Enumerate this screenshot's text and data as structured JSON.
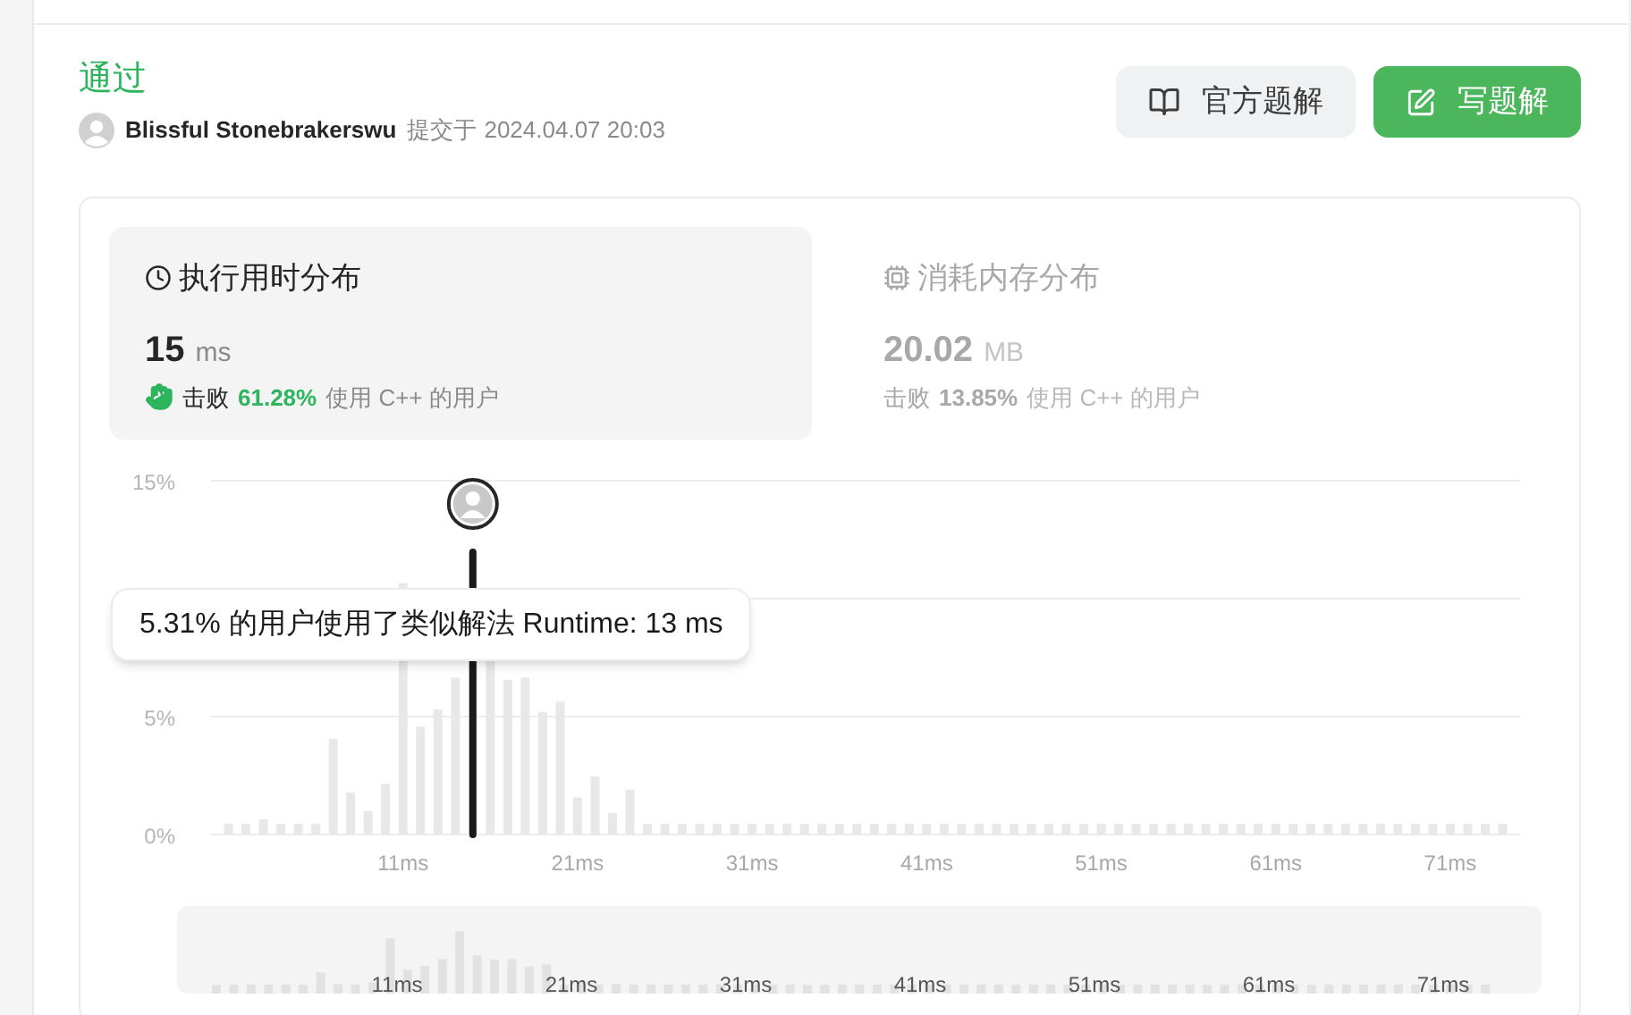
{
  "header": {
    "verdict": "通过",
    "user": "Blissful Stonebrakerswu",
    "submitted_label": "提交于",
    "submitted_time": "2024.04.07 20:03"
  },
  "buttons": [
    {
      "label": "官方题解",
      "kind": "secondary"
    },
    {
      "label": "写题解",
      "kind": "primary"
    }
  ],
  "stats": [
    {
      "kind": "time",
      "title": "执行用时分布",
      "value": "15",
      "unit": "ms",
      "beat_label": "击败",
      "beat_percent": "61.28%",
      "beat_suffix": "使用 C++ 的用户",
      "selected": true
    },
    {
      "kind": "memory",
      "title": "消耗内存分布",
      "value": "20.02",
      "unit": "MB",
      "beat_label": "击败",
      "beat_percent": "13.85%",
      "beat_suffix": "使用 C++ 的用户",
      "selected": false
    }
  ],
  "chart": {
    "chart_data": {
      "type": "bar",
      "x": [
        1,
        2,
        3,
        4,
        5,
        6,
        7,
        8,
        9,
        10,
        11,
        12,
        13,
        14,
        15,
        16,
        17,
        18,
        19,
        20,
        21,
        22,
        23,
        24,
        25,
        26,
        27,
        28,
        29,
        30,
        31,
        32,
        33,
        34,
        35,
        36,
        37,
        38,
        39,
        40,
        41,
        42,
        43,
        44,
        45,
        46,
        47,
        48,
        49,
        50,
        51,
        52,
        53,
        54,
        55,
        56,
        57,
        58,
        59,
        60,
        61,
        62,
        63,
        64,
        65,
        66,
        67,
        68,
        69,
        70,
        71,
        72,
        73,
        74
      ],
      "xlim": [
        0,
        75
      ],
      "series": [
        {
          "color": "#e8e8e8",
          "values": [
            0.45,
            0.45,
            0.65,
            0.45,
            0.45,
            0.45,
            4.06,
            1.78,
            1.0,
            2.16,
            10.66,
            4.57,
            5.31,
            6.65,
            12.0,
            7.36,
            6.55,
            6.65,
            5.2,
            5.63,
            1.57,
            2.46,
            0.91,
            1.9,
            0.45,
            0.45,
            0.45,
            0.45,
            0.45,
            0.45,
            0.45,
            0.45,
            0.45,
            0.45,
            0.45,
            0.45,
            0.45,
            0.45,
            0.45,
            0.45,
            0.45,
            0.45,
            0.45,
            0.45,
            0.45,
            0.45,
            0.45,
            0.45,
            0.45,
            0.45,
            0.45,
            0.45,
            0.45,
            0.45,
            0.45,
            0.45,
            0.45,
            0.45,
            0.45,
            0.45,
            0.45,
            0.45,
            0.45,
            0.45,
            0.45,
            0.45,
            0.45,
            0.45,
            0.45,
            0.45,
            0.45,
            0.45,
            0.45,
            0.45
          ]
        }
      ],
      "xticks": [
        {
          "value": 11,
          "label": "11ms"
        },
        {
          "value": 21,
          "label": "21ms"
        },
        {
          "value": 31,
          "label": "31ms"
        },
        {
          "value": 41,
          "label": "41ms"
        },
        {
          "value": 51,
          "label": "51ms"
        },
        {
          "value": 61,
          "label": "61ms"
        },
        {
          "value": 71,
          "label": "71ms"
        }
      ],
      "yticks": [
        {
          "value": 0,
          "label": "0%"
        },
        {
          "value": 5,
          "label": "5%"
        },
        {
          "value": 15,
          "label": "15%"
        }
      ],
      "ylim": [
        0,
        15
      ]
    },
    "tooltip": {
      "text": "5.31% 的用户使用了类似解法 Runtime: 13 ms"
    },
    "brush": {
      "labels": [
        "11ms",
        "21ms",
        "31ms",
        "41ms",
        "51ms",
        "61ms",
        "71ms"
      ]
    }
  }
}
